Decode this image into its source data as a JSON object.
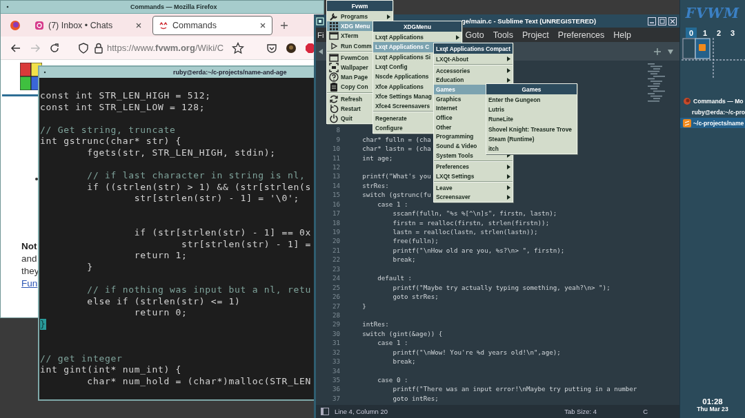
{
  "firefox": {
    "title": "Commands — Mozilla Firefox",
    "tabs": [
      {
        "label": "(7) Inbox • Chats",
        "selected": false
      },
      {
        "label": "Commands",
        "selected": true
      }
    ],
    "nav": [
      {
        "kind": "back",
        "disabled": false
      },
      {
        "kind": "forward",
        "disabled": true
      },
      {
        "kind": "reload",
        "disabled": false
      }
    ],
    "url": "https://www.**fvwm.org**/Wiki/C",
    "page": [
      {
        "text": "Not",
        "kind": "heading"
      },
      {
        "text": "and",
        "kind": "text"
      },
      {
        "text": "they",
        "kind": "text"
      },
      {
        "text": "Fun",
        "kind": "link"
      }
    ]
  },
  "terminal": {
    "title": "ruby@erda:~/c-projects/name-and-age",
    "lines": [
      {
        "kind": "code",
        "text": "const int STR_LEN_HIGH = 512;"
      },
      {
        "kind": "code",
        "text": "const int STR_LEN_LOW = 128;"
      },
      {
        "kind": "blank"
      },
      {
        "kind": "comment",
        "text": "// Get string, truncate"
      },
      {
        "kind": "code",
        "text": "int gstrunc(char* str) {"
      },
      {
        "kind": "code",
        "text": "        fgets(str, STR_LEN_HIGH, stdin);"
      },
      {
        "kind": "blank"
      },
      {
        "kind": "comment",
        "text": "        // if last character in string is nl,"
      },
      {
        "kind": "code",
        "text": "        if ((strlen(str) > 1) && (str[strlen(s"
      },
      {
        "kind": "code",
        "text": "                str[strlen(str) - 1] = '\\0';"
      },
      {
        "kind": "blank"
      },
      {
        "kind": "blank"
      },
      {
        "kind": "code",
        "text": "                if (str[strlen(str) - 1] == 0x"
      },
      {
        "kind": "code",
        "text": "                        str[strlen(str) - 1] ="
      },
      {
        "kind": "code",
        "text": "                return 1;"
      },
      {
        "kind": "code",
        "text": "        }"
      },
      {
        "kind": "blank"
      },
      {
        "kind": "comment",
        "text": "        // if nothing was input but a nl, retu"
      },
      {
        "kind": "code",
        "text": "        else if (strlen(str) <= 1)"
      },
      {
        "kind": "code",
        "text": "                return 0;"
      },
      {
        "kind": "cursor",
        "text": "}"
      },
      {
        "kind": "blank"
      },
      {
        "kind": "blank"
      },
      {
        "kind": "comment",
        "text": "// get integer"
      },
      {
        "kind": "code",
        "text": "int gint(int* num_int) {"
      },
      {
        "kind": "code",
        "text": "        char* num_hold = (char*)malloc(STR_LEN"
      }
    ]
  },
  "sublime": {
    "title": "ge/main.c - Sublime Text (UNREGISTERED)",
    "menu_cut": "Fi",
    "menu": [
      "Goto",
      "Tools",
      "Project",
      "Preferences",
      "Help"
    ],
    "lines": [
      {
        "num": "8"
      },
      {
        "num": "9",
        "text": "    char* fulln = (cha"
      },
      {
        "num": "10",
        "text": "    char* lastn = (cha"
      },
      {
        "num": "11",
        "text": "    int age;"
      },
      {
        "num": "12"
      },
      {
        "num": "13",
        "text": "    printf(\"What's you"
      },
      {
        "num": "14",
        "text": "    strRes:"
      },
      {
        "num": "15",
        "text": "    switch (gstrunc(fu"
      },
      {
        "num": "16",
        "text": "        case 1 :"
      },
      {
        "num": "17",
        "text": "            sscanf(fulln, \"%s %[^\\n]s\", firstn, lastn);"
      },
      {
        "num": "18",
        "text": "            firstn = realloc(firstn, strlen(firstn));"
      },
      {
        "num": "19",
        "text": "            lastn = realloc(lastn, strlen(lastn));"
      },
      {
        "num": "20",
        "text": "            free(fulln);"
      },
      {
        "num": "21",
        "text": "            printf(\"\\nHow old are you, %s?\\n> \", firstn);"
      },
      {
        "num": "22",
        "text": "            break;"
      },
      {
        "num": "23"
      },
      {
        "num": "24",
        "text": "        default :"
      },
      {
        "num": "25",
        "text": "            printf(\"Maybe try actually typing something, yeah?\\n> \");"
      },
      {
        "num": "26",
        "text": "            goto strRes;"
      },
      {
        "num": "27",
        "text": "    }"
      },
      {
        "num": "28"
      },
      {
        "num": "29",
        "text": "    intRes:"
      },
      {
        "num": "30",
        "text": "    switch (gint(&age)) {"
      },
      {
        "num": "31",
        "text": "        case 1 :"
      },
      {
        "num": "32",
        "text": "            printf(\"\\nWow! You're %d years old!\\n\",age);"
      },
      {
        "num": "33",
        "text": "            break;"
      },
      {
        "num": "34"
      },
      {
        "num": "35",
        "text": "        case 0 :"
      },
      {
        "num": "36",
        "text": "            printf(\"There was an input error!\\nMaybe try putting in a number"
      },
      {
        "num": "37",
        "text": "            goto intRes;"
      }
    ],
    "status": {
      "position": "Line 4, Column 20",
      "tab_size": "Tab Size: 4",
      "syntax": "C"
    }
  },
  "menus": [
    {
      "title": "Fvwm",
      "items": [
        {
          "label": "Programs",
          "selected": false,
          "submenu": true,
          "separator_before": false
        },
        {
          "label": "XDG Menu",
          "selected": true,
          "submenu": false,
          "separator_before": false
        },
        {
          "label": "XTerm",
          "selected": false,
          "submenu": false,
          "separator_before": false
        },
        {
          "label": "Run Comm",
          "selected": false,
          "submenu": false,
          "separator_before": false
        },
        {
          "label": "FvwmCon",
          "selected": false,
          "submenu": false,
          "separator_before": true
        },
        {
          "label": "Wallpaper",
          "selected": false,
          "submenu": false,
          "separator_before": false
        },
        {
          "label": "Man Page",
          "selected": false,
          "submenu": false,
          "separator_before": false
        },
        {
          "label": "Copy Con",
          "selected": false,
          "submenu": false,
          "separator_before": false
        },
        {
          "label": "Refresh",
          "selected": false,
          "submenu": false,
          "separator_before": true
        },
        {
          "label": "Restart",
          "selected": false,
          "submenu": false,
          "separator_before": false
        },
        {
          "label": "Quit",
          "selected": false,
          "submenu": false,
          "separator_before": false
        }
      ]
    },
    {
      "title": "XDGMenu",
      "items": [
        {
          "label": "Lxqt Applications",
          "selected": false,
          "submenu": true,
          "separator_before": false
        },
        {
          "label": "Lxqt Applications C",
          "selected": true,
          "submenu": false,
          "separator_before": false
        },
        {
          "label": "Lxqt Applications Si",
          "selected": false,
          "submenu": false,
          "separator_before": false
        },
        {
          "label": "Lxqt Config",
          "selected": false,
          "submenu": false,
          "separator_before": false
        },
        {
          "label": "Nscde Applications",
          "selected": false,
          "submenu": false,
          "separator_before": false
        },
        {
          "label": "Xfce Applications",
          "selected": false,
          "submenu": false,
          "separator_before": false
        },
        {
          "label": "Xfce Settings Manag",
          "selected": false,
          "submenu": false,
          "separator_before": false
        },
        {
          "label": "Xfce4 Screensavers",
          "selected": false,
          "submenu": false,
          "separator_before": false
        },
        {
          "label": "Regenerate",
          "selected": false,
          "submenu": false,
          "separator_before": true
        },
        {
          "label": "Configure",
          "selected": false,
          "submenu": false,
          "separator_before": false
        }
      ]
    },
    {
      "title": "Lxqt Applications Compact",
      "items": [
        {
          "label": "LXQt-About",
          "selected": false,
          "submenu": true,
          "separator_before": false
        },
        {
          "label": "Accessories",
          "selected": false,
          "submenu": true,
          "separator_before": true
        },
        {
          "label": "Education",
          "selected": false,
          "submenu": true,
          "separator_before": false
        },
        {
          "label": "Games",
          "selected": true,
          "submenu": false,
          "separator_before": false
        },
        {
          "label": "Graphics",
          "selected": false,
          "submenu": false,
          "separator_before": false
        },
        {
          "label": "Internet",
          "selected": false,
          "submenu": false,
          "separator_before": false
        },
        {
          "label": "Office",
          "selected": false,
          "submenu": false,
          "separator_before": false
        },
        {
          "label": "Other",
          "selected": false,
          "submenu": false,
          "separator_before": false
        },
        {
          "label": "Programming",
          "selected": false,
          "submenu": false,
          "separator_before": false
        },
        {
          "label": "Sound & Video",
          "selected": false,
          "submenu": false,
          "separator_before": false
        },
        {
          "label": "System Tools",
          "selected": false,
          "submenu": true,
          "separator_before": false
        },
        {
          "label": "Preferences",
          "selected": false,
          "submenu": true,
          "separator_before": true
        },
        {
          "label": "LXQt Settings",
          "selected": false,
          "submenu": true,
          "separator_before": false
        },
        {
          "label": "Leave",
          "selected": false,
          "submenu": true,
          "separator_before": true
        },
        {
          "label": "Screensaver",
          "selected": false,
          "submenu": true,
          "separator_before": false
        }
      ]
    },
    {
      "title": "Games",
      "items": [
        {
          "label": "Enter the Gungeon",
          "selected": false,
          "submenu": false,
          "separator_before": false
        },
        {
          "label": "Lutris",
          "selected": false,
          "submenu": false,
          "separator_before": false
        },
        {
          "label": "RuneLite",
          "selected": false,
          "submenu": false,
          "separator_before": false
        },
        {
          "label": "Shovel Knight: Treasure Trove",
          "selected": false,
          "submenu": false,
          "separator_before": false
        },
        {
          "label": "Steam (Runtime)",
          "selected": false,
          "submenu": false,
          "separator_before": false
        },
        {
          "label": "itch",
          "selected": false,
          "submenu": false,
          "separator_before": false
        }
      ]
    }
  ],
  "panel": {
    "logo": "FVWM",
    "desks": [
      {
        "label": "0",
        "selected": true
      },
      {
        "label": "1",
        "selected": false
      },
      {
        "label": "2",
        "selected": false
      },
      {
        "label": "3",
        "selected": false
      }
    ],
    "windows": [
      {
        "label": "Commands — Mo",
        "selected": false
      },
      {
        "label": "ruby@erda:~/c-pro",
        "selected": false
      },
      {
        "label": "~/c-projects/name",
        "selected": true
      }
    ],
    "clock": {
      "time": "01:28",
      "date": "Thu Mar 23"
    }
  }
}
